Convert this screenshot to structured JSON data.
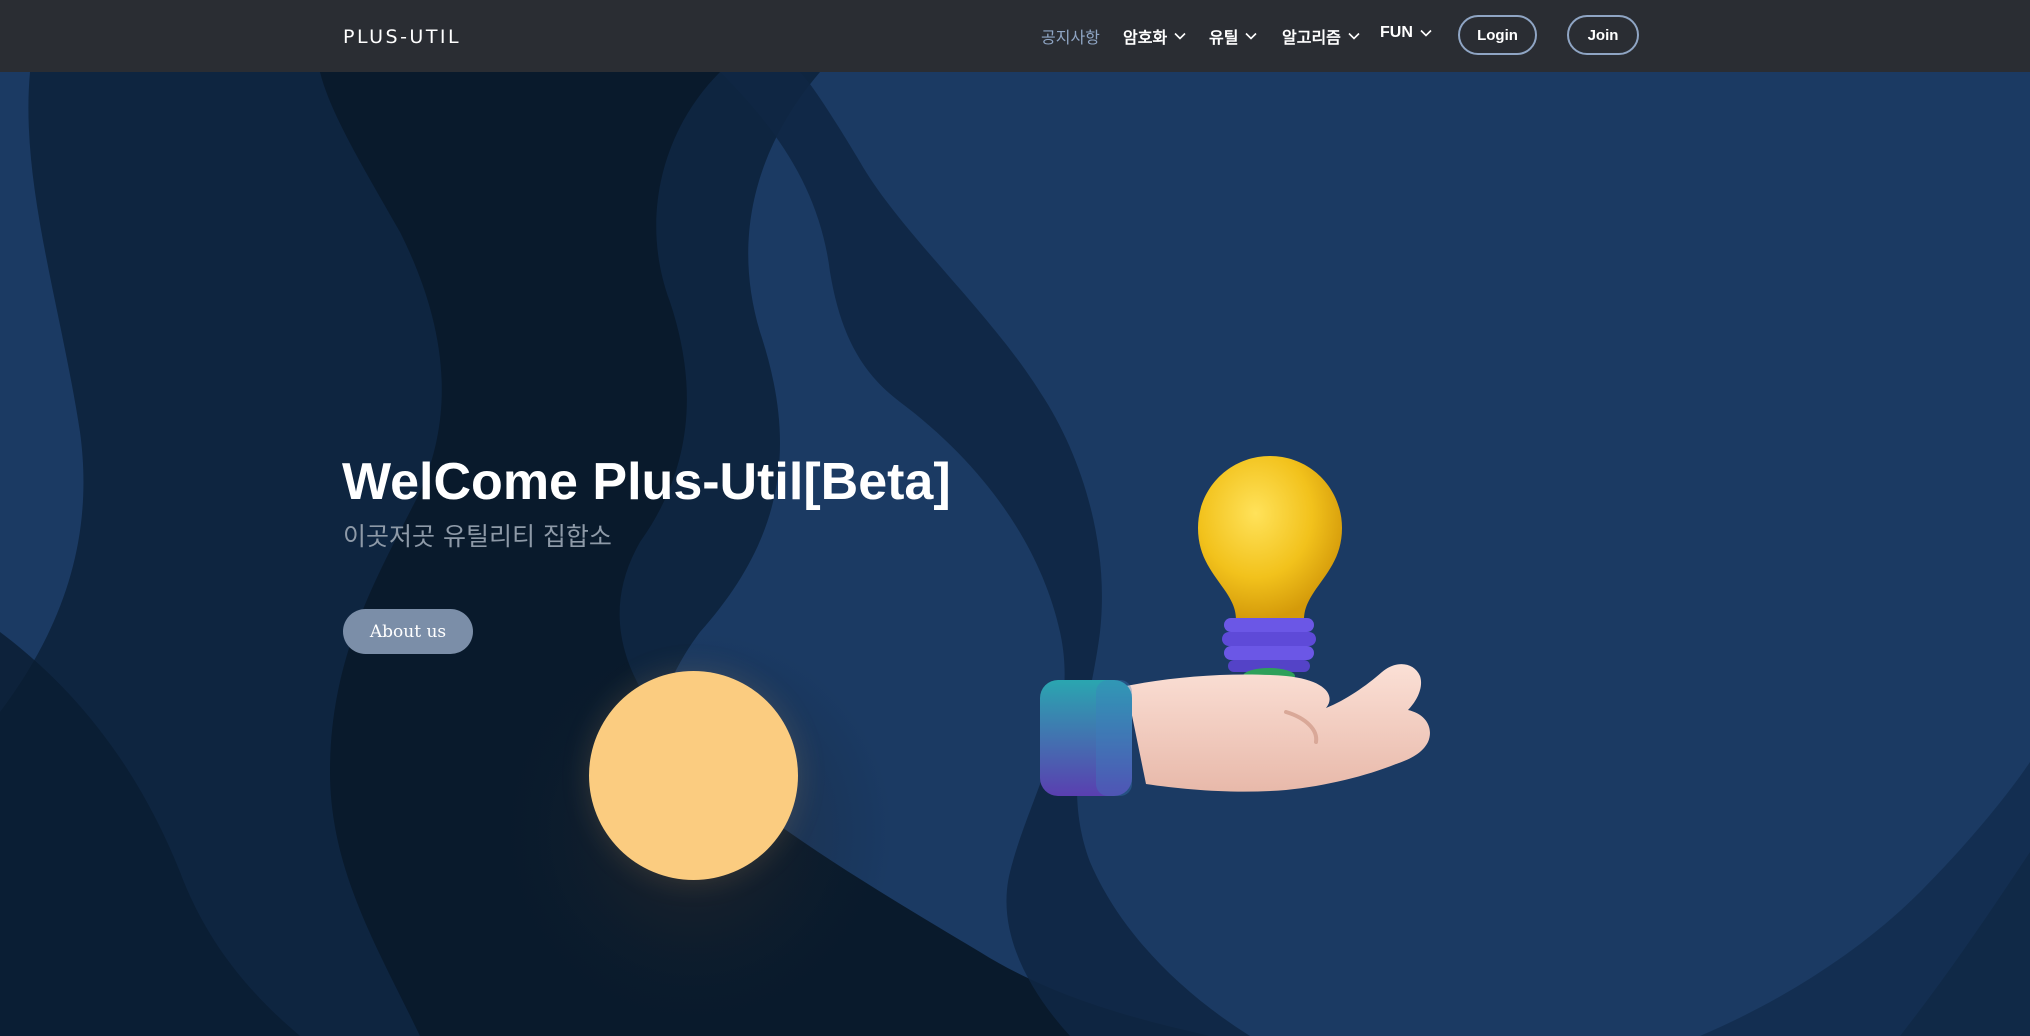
{
  "nav": {
    "brand": "PLUS-UTIL",
    "items": [
      {
        "label": "공지사항",
        "has_dropdown": false,
        "active": true
      },
      {
        "label": "암호화",
        "has_dropdown": true
      },
      {
        "label": "유틸",
        "has_dropdown": true
      },
      {
        "label": "알고리즘",
        "has_dropdown": true
      },
      {
        "label": "FUN",
        "has_dropdown": true
      }
    ],
    "login_label": "Login",
    "join_label": "Join"
  },
  "hero": {
    "title": "WelCome Plus-Util[Beta]",
    "subtitle": "이곳저곳 유틸리티 집합소",
    "about_label": "About us"
  },
  "colors": {
    "navbar_bg": "#2a2d33",
    "hero_blue": "#1b3a63",
    "hero_dark": "#0b1f33",
    "accent": "#8fa5c4",
    "moon": "#fbcc80",
    "button_bg": "#7b8ea8"
  },
  "icons": {
    "dropdown": "chevron-down-icon",
    "illustration": "lightbulb-on-hand"
  }
}
